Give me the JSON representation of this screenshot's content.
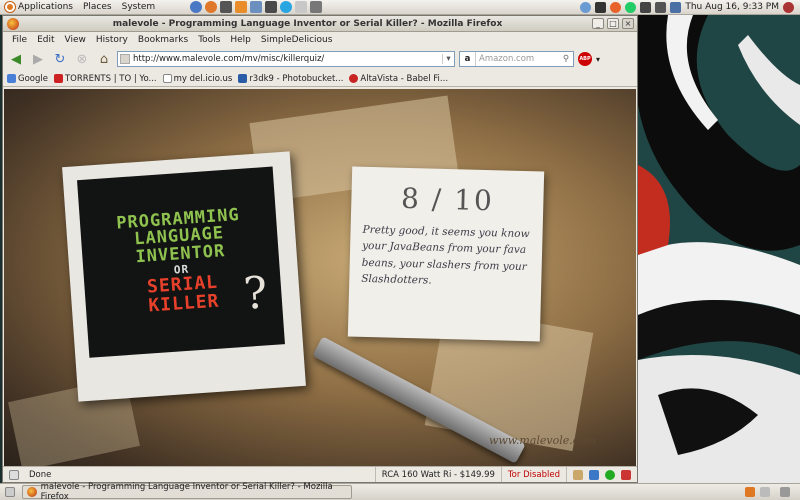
{
  "panel": {
    "menus": [
      "Applications",
      "Places",
      "System"
    ],
    "clock": "Thu Aug 16,  9:33 PM"
  },
  "window": {
    "title": "malevole - Programming Language Inventor or Serial Killer? - Mozilla Firefox"
  },
  "menubar": [
    "File",
    "Edit",
    "View",
    "History",
    "Bookmarks",
    "Tools",
    "Help",
    "SimpleDelicious"
  ],
  "navbar": {
    "url": "http://www.malevole.com/mv/misc/killerquiz/",
    "search_placeholder": "Amazon.com",
    "search_engine_icon": "a"
  },
  "bookmarks": [
    {
      "label": "Google",
      "color": "#4a7fd8"
    },
    {
      "label": "TORRENTS | TO | Yo...",
      "color": "#cc2222"
    },
    {
      "label": "my del.icio.us",
      "color": "#3366cc"
    },
    {
      "label": "r3dk9 - Photobucket...",
      "color": "#2a5ca8"
    },
    {
      "label": "AltaVista - Babel Fi...",
      "color": "#c92424"
    }
  ],
  "page": {
    "quiz_title": {
      "line1": "PROGRAMMING",
      "line2": "LANGUAGE",
      "line3": "INVENTOR",
      "or": "OR",
      "line4": "SERIAL",
      "line5": "KILLER",
      "qmark": "?"
    },
    "score": "8 / 10",
    "result": "Pretty good, it seems you know your JavaBeans from your fava beans, your slashers from your Slashdotters.",
    "watermark": "www.malevole.com"
  },
  "statusbar": {
    "status": "Done",
    "ad": "RCA 160 Watt Ri - $149.99",
    "tor": "Tor Disabled"
  },
  "taskbar": {
    "task_label": "malevole - Programming Language Inventor or Serial Killer? - Mozilla Firefox"
  }
}
